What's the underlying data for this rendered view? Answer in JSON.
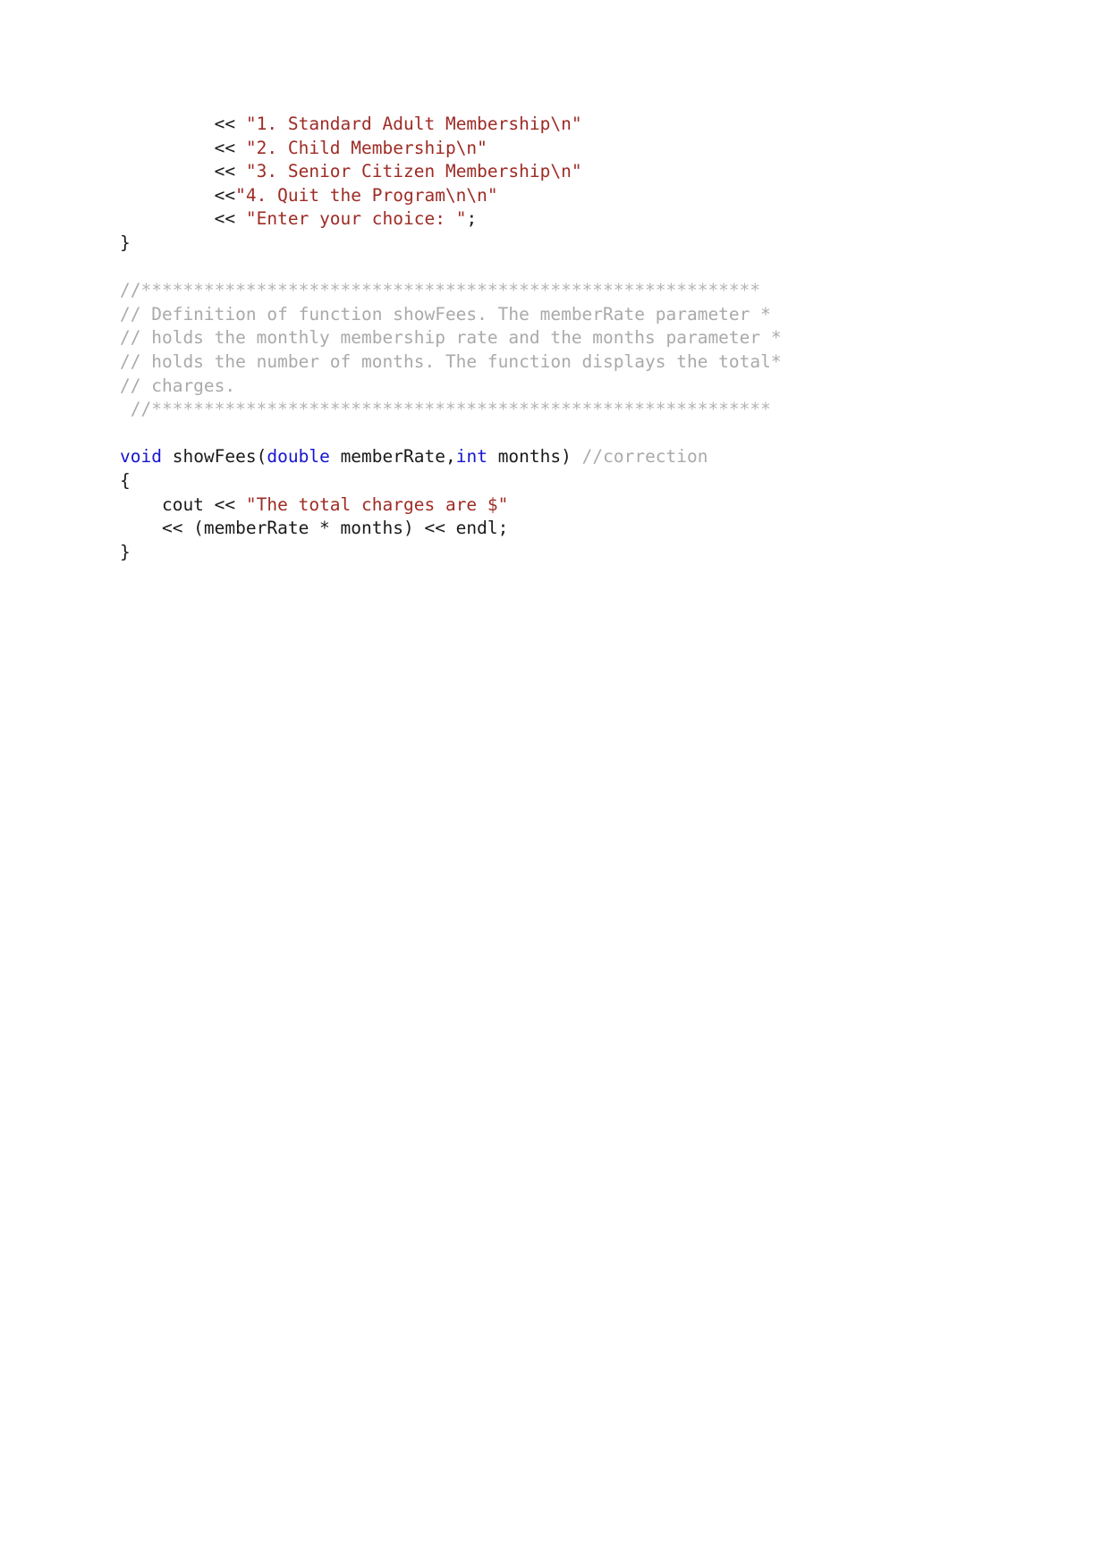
{
  "document": {
    "kind": "source-code-listing",
    "language": "C++",
    "colors": {
      "background": "#ffffff",
      "plain": "#1a1a1a",
      "string": "#9e2b25",
      "keyword": "#1515d0",
      "comment": "#aaaaaa"
    }
  },
  "code": {
    "lines": [
      {
        "id": "line-1",
        "tokens": [
          {
            "kind": "plain",
            "text": "         << "
          },
          {
            "kind": "string",
            "text": "\"1. Standard Adult Membership\\n\""
          }
        ]
      },
      {
        "id": "line-2",
        "tokens": [
          {
            "kind": "plain",
            "text": "         << "
          },
          {
            "kind": "string",
            "text": "\"2. Child Membership\\n\""
          }
        ]
      },
      {
        "id": "line-3",
        "tokens": [
          {
            "kind": "plain",
            "text": "         << "
          },
          {
            "kind": "string",
            "text": "\"3. Senior Citizen Membership\\n\""
          }
        ]
      },
      {
        "id": "line-4",
        "tokens": [
          {
            "kind": "plain",
            "text": "         <<"
          },
          {
            "kind": "string",
            "text": "\"4. Quit the Program\\n\\n\""
          }
        ]
      },
      {
        "id": "line-5",
        "tokens": [
          {
            "kind": "plain",
            "text": "         << "
          },
          {
            "kind": "string",
            "text": "\"Enter your choice: \""
          },
          {
            "kind": "plain",
            "text": ";"
          }
        ]
      },
      {
        "id": "line-6",
        "tokens": [
          {
            "kind": "plain",
            "text": "}"
          }
        ]
      },
      {
        "id": "line-7",
        "tokens": [
          {
            "kind": "plain",
            "text": ""
          }
        ]
      },
      {
        "id": "line-8",
        "tokens": [
          {
            "kind": "comment",
            "text": "//"
          },
          {
            "kind": "stars",
            "text": "***********************************************************"
          }
        ]
      },
      {
        "id": "line-9",
        "tokens": [
          {
            "kind": "comment",
            "text": "// Definition of function showFees. The memberRate parameter *"
          }
        ]
      },
      {
        "id": "line-10",
        "tokens": [
          {
            "kind": "comment",
            "text": "// holds the monthly membership rate and the months parameter *"
          }
        ]
      },
      {
        "id": "line-11",
        "tokens": [
          {
            "kind": "comment",
            "text": "// holds the number of months. The function displays the total*"
          }
        ]
      },
      {
        "id": "line-12",
        "tokens": [
          {
            "kind": "comment",
            "text": "// charges."
          }
        ]
      },
      {
        "id": "line-13",
        "tokens": [
          {
            "kind": "comment",
            "text": " //"
          },
          {
            "kind": "stars",
            "text": "***********************************************************"
          }
        ]
      },
      {
        "id": "line-14",
        "tokens": [
          {
            "kind": "plain",
            "text": ""
          }
        ]
      },
      {
        "id": "line-15",
        "tokens": [
          {
            "kind": "keyword",
            "text": "void"
          },
          {
            "kind": "plain",
            "text": " showFees("
          },
          {
            "kind": "keyword",
            "text": "double"
          },
          {
            "kind": "plain",
            "text": " memberRate,"
          },
          {
            "kind": "keyword",
            "text": "int"
          },
          {
            "kind": "plain",
            "text": " months) "
          },
          {
            "kind": "comment",
            "text": "//correction"
          }
        ]
      },
      {
        "id": "line-16",
        "tokens": [
          {
            "kind": "plain",
            "text": "{"
          }
        ]
      },
      {
        "id": "line-17",
        "tokens": [
          {
            "kind": "plain",
            "text": "    cout << "
          },
          {
            "kind": "string",
            "text": "\"The total charges are $\""
          }
        ]
      },
      {
        "id": "line-18",
        "tokens": [
          {
            "kind": "plain",
            "text": "    << (memberRate * months) << endl;"
          }
        ]
      },
      {
        "id": "line-19",
        "tokens": [
          {
            "kind": "plain",
            "text": "}"
          }
        ]
      }
    ]
  }
}
